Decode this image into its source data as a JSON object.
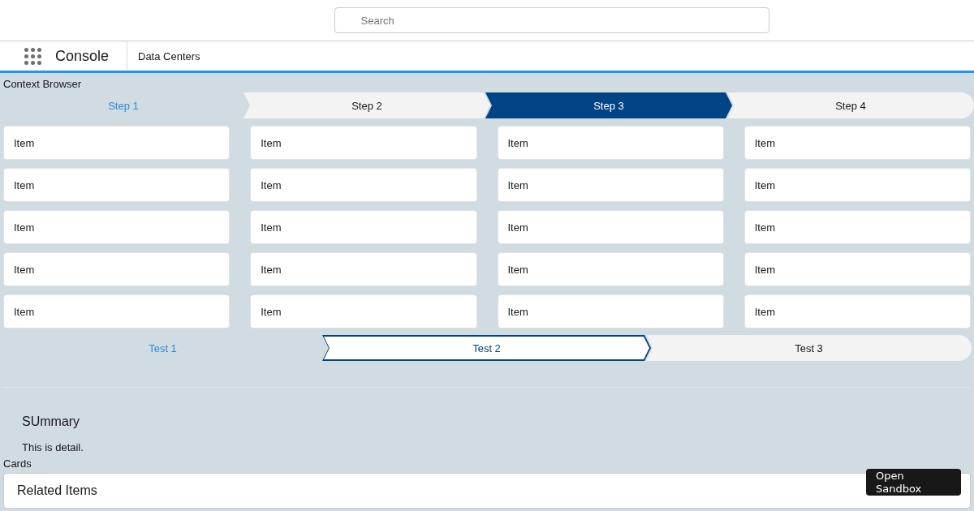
{
  "search": {
    "placeholder": "Search"
  },
  "app": {
    "name": "Console",
    "nav_tab": "Data Centers"
  },
  "context_browser": {
    "label": "Context Browser",
    "steps_path": {
      "kind": "filled",
      "steps": [
        {
          "label": "Step 1",
          "completed": true,
          "selected": false
        },
        {
          "label": "Step 2",
          "completed": false,
          "selected": false
        },
        {
          "label": "Step 3",
          "completed": false,
          "selected": true
        },
        {
          "label": "Step 4",
          "completed": false,
          "selected": false
        }
      ]
    },
    "items": [
      {
        "label": "Item"
      },
      {
        "label": "Item"
      },
      {
        "label": "Item"
      },
      {
        "label": "Item"
      },
      {
        "label": "Item"
      },
      {
        "label": "Item"
      },
      {
        "label": "Item"
      },
      {
        "label": "Item"
      },
      {
        "label": "Item"
      },
      {
        "label": "Item"
      },
      {
        "label": "Item"
      },
      {
        "label": "Item"
      },
      {
        "label": "Item"
      },
      {
        "label": "Item"
      },
      {
        "label": "Item"
      },
      {
        "label": "Item"
      },
      {
        "label": "Item"
      },
      {
        "label": "Item"
      },
      {
        "label": "Item"
      },
      {
        "label": "Item"
      }
    ],
    "tests_path": {
      "kind": "outlined",
      "steps": [
        {
          "label": "Test 1",
          "completed": true,
          "selected": false
        },
        {
          "label": "Test 2",
          "completed": false,
          "selected": true
        },
        {
          "label": "Test 3",
          "completed": false,
          "selected": false
        }
      ]
    }
  },
  "summary": {
    "title": "SUmmary",
    "detail": "This is detail."
  },
  "cards": {
    "label": "Cards",
    "items": [
      {
        "title": "Related Items"
      }
    ]
  },
  "sandbox_button": {
    "label": "Open Sandbox"
  }
}
